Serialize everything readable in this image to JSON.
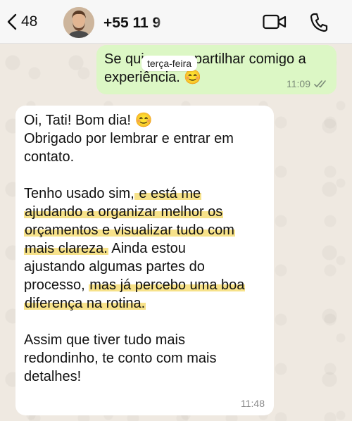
{
  "header": {
    "back_count": "48",
    "contact_name": "+55 11 9",
    "avatar_label": "Contact avatar"
  },
  "date_separator": "terça-feira",
  "messages": {
    "outgoing": {
      "text": "Se quiser compartilhar comigo a\nexperiência. 😊",
      "time": "11:09",
      "status": "read"
    },
    "incoming": {
      "p1_l1": "Oi, Tati! Bom dia! 😊",
      "p1_l2": "Obrigado por lembrar e entrar em",
      "p1_l3": "contato.",
      "p2_l1a": "Tenho usado sim,",
      "p2_l1b": " e está me",
      "p2_l2": "ajudando a organizar melhor os",
      "p2_l3": "orçamentos e visualizar tudo com",
      "p2_l4a": "mais clareza.",
      "p2_l4b": " Ainda estou",
      "p2_l5": "ajustando algumas partes do",
      "p2_l6a": "processo, ",
      "p2_l6b": "mas já percebo uma boa",
      "p2_l7": "diferença na rotina.",
      "p3_l1": "Assim que tiver tudo mais",
      "p3_l2": "redondinho, te conto com mais",
      "p3_l3": "detalhes!",
      "time": "11:48"
    }
  },
  "colors": {
    "outgoing_bubble": "#dcf7c5",
    "incoming_bubble": "#ffffff",
    "wallpaper": "#efe9e1",
    "highlight": "#f7e28a"
  },
  "icons": [
    "back-chevron-icon",
    "video-call-icon",
    "phone-call-icon",
    "double-check-icon"
  ]
}
